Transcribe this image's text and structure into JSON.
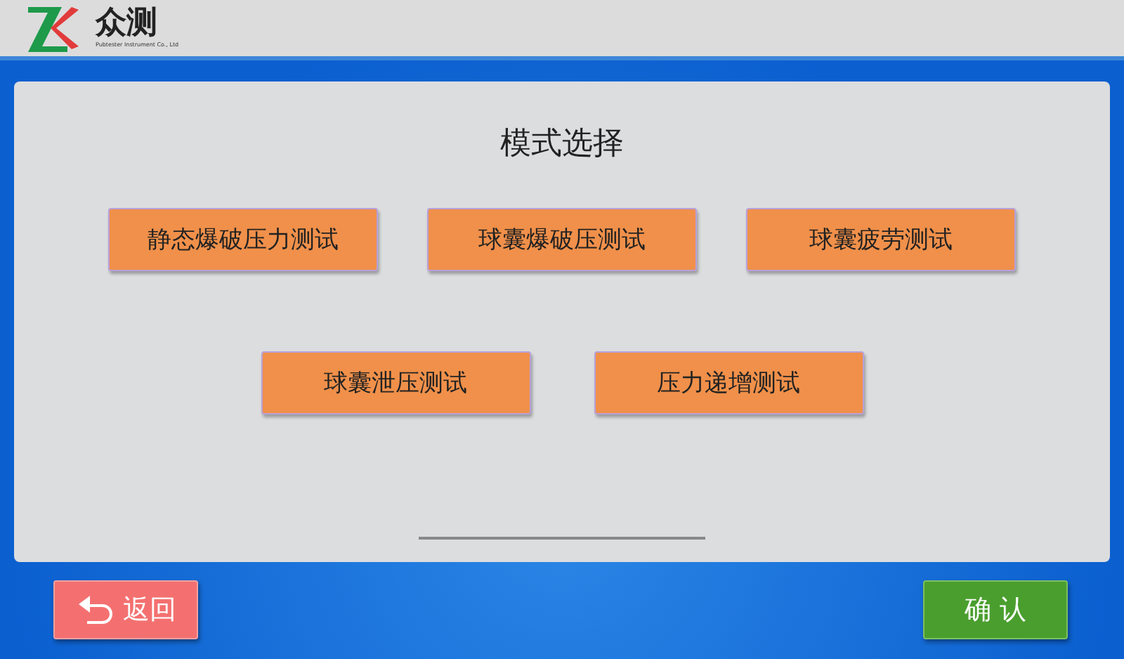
{
  "header": {
    "logo_text": "众测",
    "logo_subtitle": "Pubtester Instrument Co., Ltd"
  },
  "panel": {
    "title": "模式选择",
    "mode_rows": [
      [
        "静态爆破压力测试",
        "球囊爆破压测试",
        "球囊疲劳测试"
      ],
      [
        "球囊泄压测试",
        "压力递增测试"
      ]
    ]
  },
  "footer": {
    "back_button": "返回",
    "confirm_button": "确 认"
  }
}
